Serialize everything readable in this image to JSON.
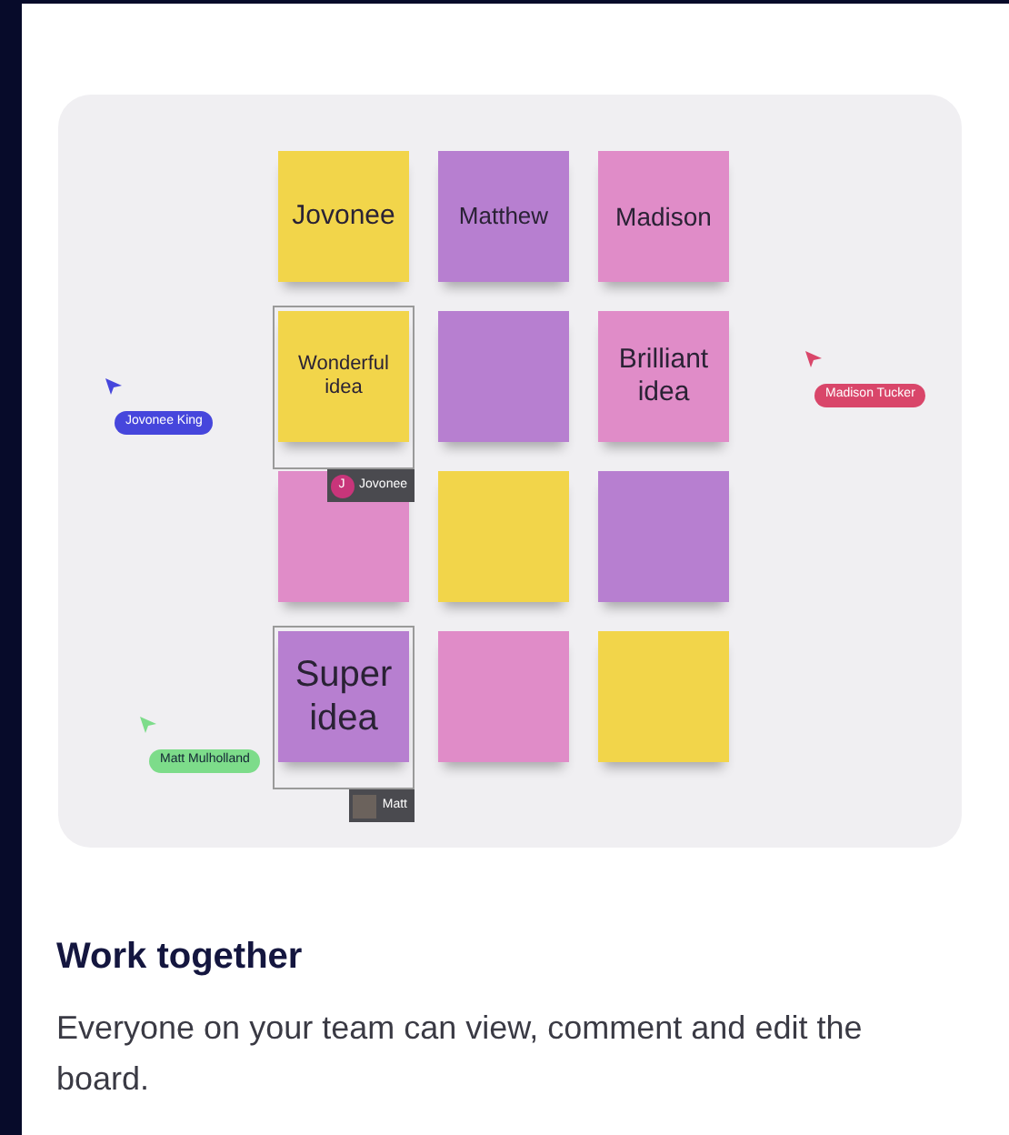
{
  "board": {
    "notes": [
      {
        "text": "Jovonee",
        "color": "#f2d54a"
      },
      {
        "text": "Matthew",
        "color": "#b77fd0"
      },
      {
        "text": "Madison",
        "color": "#e08cc8"
      },
      {
        "text": "Wonderful idea",
        "color": "#f2d54a",
        "selected_by": {
          "label": "Jovonee",
          "avatar": {
            "kind": "initial",
            "text": "J"
          }
        }
      },
      {
        "color": "#b77fd0"
      },
      {
        "text": "Brilliant idea",
        "color": "#e08cc8"
      },
      {
        "color": "#e08cc8"
      },
      {
        "color": "#f2d54a"
      },
      {
        "color": "#b77fd0"
      },
      {
        "text": "Super idea",
        "color": "#b77fd0",
        "selected_by": {
          "label": "Matt",
          "avatar": {
            "kind": "photo"
          }
        }
      },
      {
        "color": "#e08cc8"
      },
      {
        "color": "#f2d54a"
      }
    ],
    "cursors": [
      {
        "name": "Jovonee King",
        "color": "#4646dc"
      },
      {
        "name": "Madison Tucker",
        "color": "#d9466a"
      },
      {
        "name": "Matt Mulholland",
        "color": "#7ddc8a"
      }
    ]
  },
  "title": "Work together",
  "description": "Everyone on your team can view, comment and edit the board."
}
